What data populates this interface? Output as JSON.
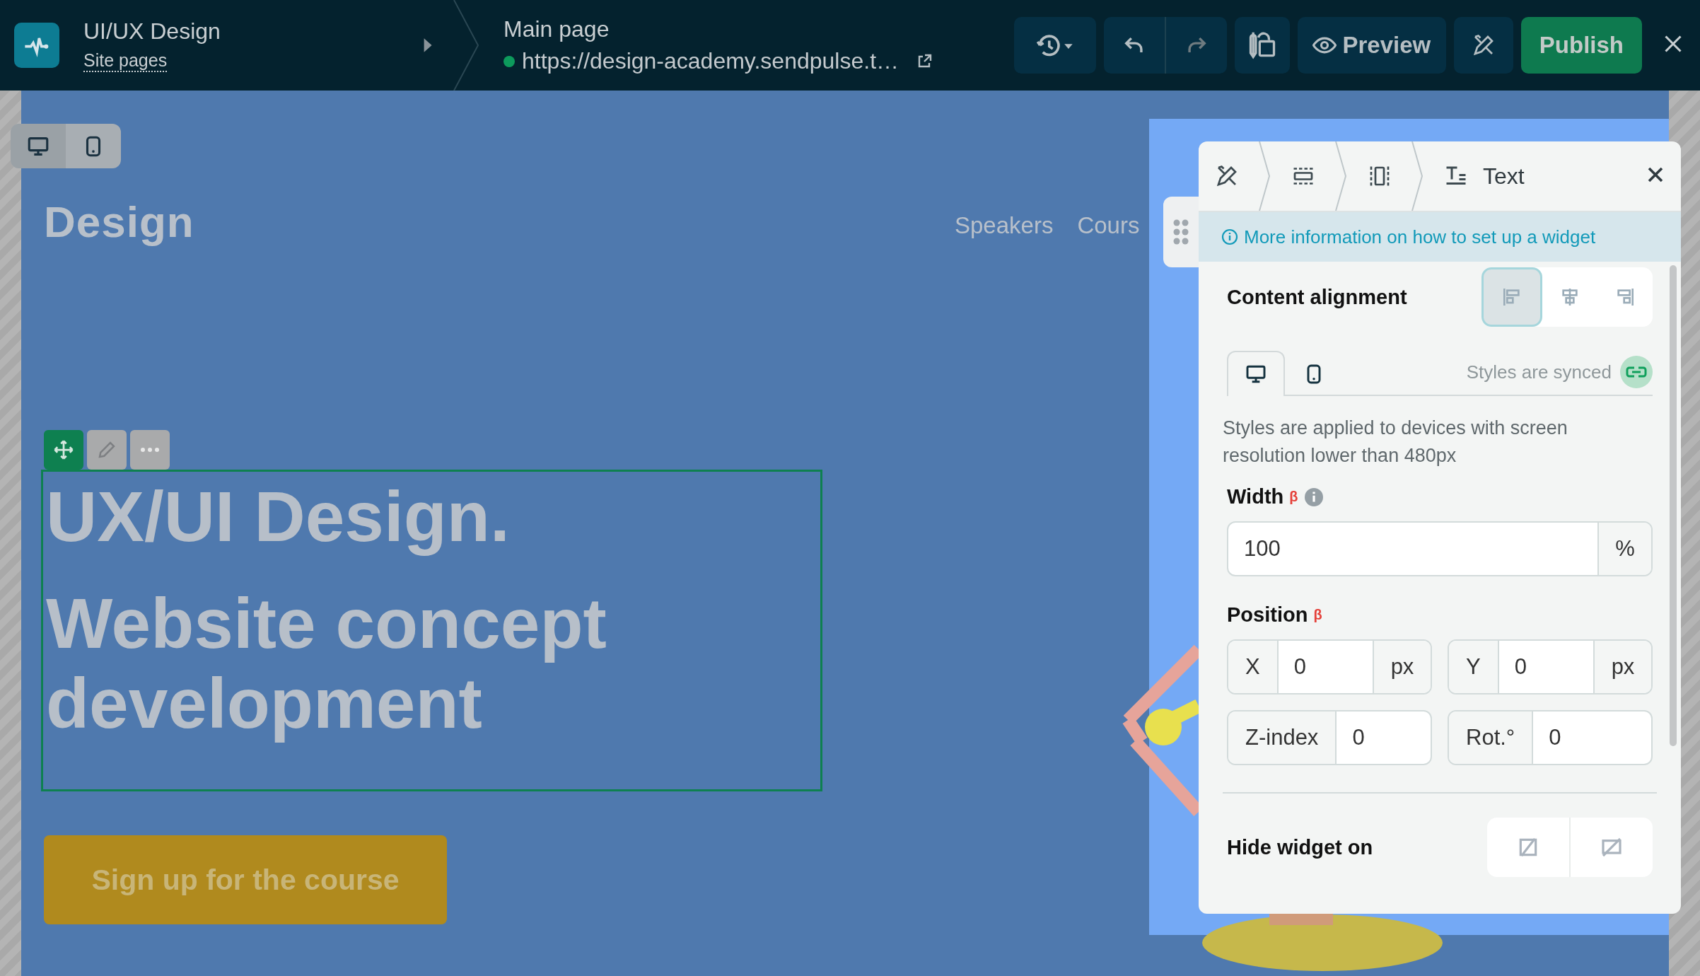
{
  "topbar": {
    "project_title": "UI/UX Design",
    "site_pages_link": "Site pages",
    "page_title": "Main page",
    "page_url": "https://design-academy.sendpulse.t…",
    "preview": "Preview",
    "publish": "Publish"
  },
  "canvas": {
    "device_toggle": [
      {
        "kind": "desktop",
        "selected": true
      },
      {
        "kind": "mobile",
        "selected": false
      }
    ],
    "site_logo": "Design",
    "nav": [
      "Speakers",
      "Cours"
    ],
    "heading": "UX/UI Design.",
    "subheading": "Website concept development",
    "cta": "Sign up for the course"
  },
  "panel": {
    "breadcrumb": [
      {
        "kind": "tools"
      },
      {
        "kind": "section"
      },
      {
        "kind": "column"
      },
      {
        "kind": "text",
        "label": "Text"
      }
    ],
    "info_link": "More information on how to set up a widget",
    "content_alignment": {
      "label": "Content alignment",
      "options": [
        {
          "kind": "left",
          "selected": true
        },
        {
          "kind": "center",
          "selected": false
        },
        {
          "kind": "right",
          "selected": false
        }
      ]
    },
    "device_tabs": [
      {
        "kind": "desktop",
        "selected": true
      },
      {
        "kind": "mobile",
        "selected": false
      }
    ],
    "sync_label": "Styles are synced",
    "note": "Styles are applied to devices with screen resolution lower than 480px",
    "width": {
      "label": "Width",
      "beta": "β",
      "value": "100",
      "unit": "%"
    },
    "position": {
      "label": "Position",
      "beta": "β",
      "fields": [
        {
          "label": "X",
          "value": "0",
          "unit": "px"
        },
        {
          "label": "Y",
          "value": "0",
          "unit": "px"
        },
        {
          "label": "Z-index",
          "value": "0"
        },
        {
          "label": "Rot.°",
          "value": "0"
        }
      ]
    },
    "hide_widget": {
      "label": "Hide widget on",
      "options": [
        {
          "kind": "desktop",
          "selected": false
        },
        {
          "kind": "mobile",
          "selected": false
        }
      ]
    }
  }
}
